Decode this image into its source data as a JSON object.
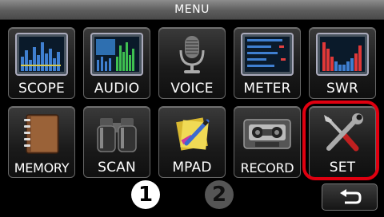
{
  "header": {
    "title": "MENU"
  },
  "tiles": [
    {
      "label": "SCOPE",
      "icon": "spectrum-scope-icon"
    },
    {
      "label": "AUDIO",
      "icon": "audio-scope-icon"
    },
    {
      "label": "VOICE",
      "icon": "microphone-icon"
    },
    {
      "label": "METER",
      "icon": "meter-icon"
    },
    {
      "label": "SWR",
      "icon": "swr-graph-icon"
    },
    {
      "label": "MEMORY",
      "icon": "memory-book-icon"
    },
    {
      "label": "SCAN",
      "icon": "binoculars-icon"
    },
    {
      "label": "MPAD",
      "icon": "memo-pad-icon"
    },
    {
      "label": "RECORD",
      "icon": "cassette-icon"
    },
    {
      "label": "SET",
      "icon": "wrench-screwdriver-icon"
    }
  ],
  "pages": {
    "current": "1",
    "next": "2"
  },
  "footer": {
    "back_icon": "return-arrow-icon"
  },
  "colors": {
    "highlight": "#e00010"
  }
}
